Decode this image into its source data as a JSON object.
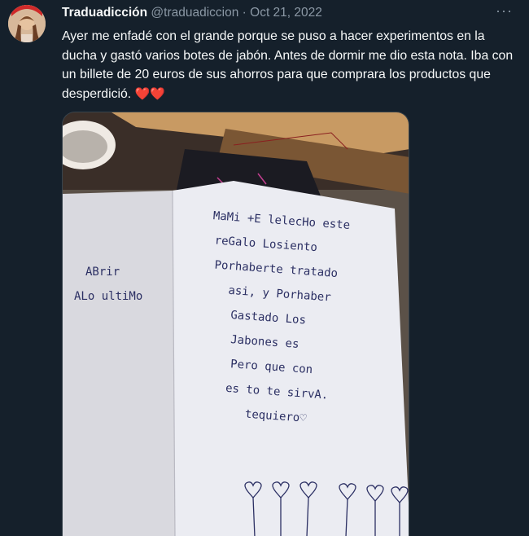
{
  "tweet": {
    "author_name": "Traduadicción",
    "author_handle": "@traduadiccion",
    "separator": "·",
    "date": "Oct 21, 2022",
    "more_label": "···",
    "text": "Ayer me enfadé con el grande porque se puso a hacer experimentos en la ducha y gastó varios botes de jabón. Antes de dormir me dio esta nota. Iba con un billete de 20 euros de sus ahorros para que comprara los productos que desperdició.",
    "emoji": "❤️❤️"
  },
  "note": {
    "left_page": [
      "ABrir",
      "ALo ultiMo"
    ],
    "right_page": [
      "MaMi +E lelecHo este",
      "reGalo Losiento",
      "Porhaberte tratado",
      "asi, y Porhaber",
      "Gastado Los",
      "Jabones es",
      "Pero que con",
      "es to te sirvA.",
      "tequiero♡"
    ]
  }
}
